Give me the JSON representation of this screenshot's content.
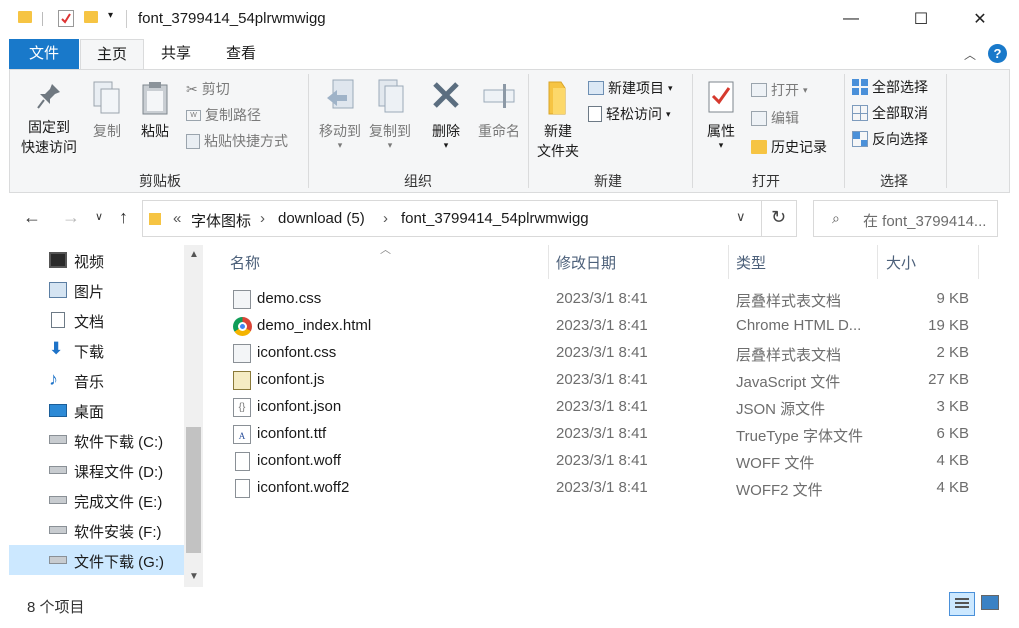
{
  "window": {
    "title": "font_3799414_54plrwmwigg",
    "controls": {
      "minimize": "—",
      "maximize": "☐",
      "close": "✕"
    }
  },
  "ribbon_tabs": [
    "文件",
    "主页",
    "共享",
    "查看"
  ],
  "ribbon": {
    "clipboard": {
      "group_label": "剪贴板",
      "pin_line1": "固定到",
      "pin_line2": "快速访问",
      "copy": "复制",
      "paste": "粘贴",
      "cut": "剪切",
      "copy_path": "复制路径",
      "paste_shortcut": "粘贴快捷方式"
    },
    "organize": {
      "group_label": "组织",
      "move_to": "移动到",
      "copy_to": "复制到",
      "delete": "删除",
      "rename": "重命名"
    },
    "new": {
      "group_label": "新建",
      "new_folder_line1": "新建",
      "new_folder_line2": "文件夹",
      "new_item": "新建项目",
      "easy_access": "轻松访问"
    },
    "open": {
      "group_label": "打开",
      "properties": "属性",
      "open": "打开",
      "edit": "编辑",
      "history": "历史记录"
    },
    "select": {
      "group_label": "选择",
      "select_all": "全部选择",
      "select_none": "全部取消",
      "invert": "反向选择"
    }
  },
  "address": {
    "overflow": "«",
    "crumbs": [
      "字体图标",
      "download (5)",
      "font_3799414_54plrwmwigg"
    ],
    "search_placeholder": "在 font_3799414..."
  },
  "nav_items": [
    {
      "label": "视频",
      "icon": "video-folder-icon"
    },
    {
      "label": "图片",
      "icon": "pictures-folder-icon"
    },
    {
      "label": "文档",
      "icon": "documents-folder-icon"
    },
    {
      "label": "下载",
      "icon": "downloads-folder-icon"
    },
    {
      "label": "音乐",
      "icon": "music-folder-icon"
    },
    {
      "label": "桌面",
      "icon": "desktop-folder-icon"
    },
    {
      "label": "软件下载 (C:)",
      "icon": "windows-drive-icon"
    },
    {
      "label": "课程文件 (D:)",
      "icon": "drive-icon"
    },
    {
      "label": "完成文件 (E:)",
      "icon": "drive-icon"
    },
    {
      "label": "软件安装 (F:)",
      "icon": "drive-icon"
    },
    {
      "label": "文件下载 (G:)",
      "icon": "drive-icon"
    }
  ],
  "columns": {
    "name": "名称",
    "date": "修改日期",
    "type": "类型",
    "size": "大小"
  },
  "files": [
    {
      "name": "demo.css",
      "date": "2023/3/1 8:41",
      "type": "层叠样式表文档",
      "size": "9 KB",
      "icon": "css-file-icon"
    },
    {
      "name": "demo_index.html",
      "date": "2023/3/1 8:41",
      "type": "Chrome HTML D...",
      "size": "19 KB",
      "icon": "chrome-icon"
    },
    {
      "name": "iconfont.css",
      "date": "2023/3/1 8:41",
      "type": "层叠样式表文档",
      "size": "2 KB",
      "icon": "css-file-icon"
    },
    {
      "name": "iconfont.js",
      "date": "2023/3/1 8:41",
      "type": "JavaScript 文件",
      "size": "27 KB",
      "icon": "js-file-icon"
    },
    {
      "name": "iconfont.json",
      "date": "2023/3/1 8:41",
      "type": "JSON 源文件",
      "size": "3 KB",
      "icon": "json-file-icon"
    },
    {
      "name": "iconfont.ttf",
      "date": "2023/3/1 8:41",
      "type": "TrueType 字体文件",
      "size": "6 KB",
      "icon": "font-file-icon"
    },
    {
      "name": "iconfont.woff",
      "date": "2023/3/1 8:41",
      "type": "WOFF 文件",
      "size": "4 KB",
      "icon": "blank-file-icon"
    },
    {
      "name": "iconfont.woff2",
      "date": "2023/3/1 8:41",
      "type": "WOFF2 文件",
      "size": "4 KB",
      "icon": "blank-file-icon"
    }
  ],
  "status": {
    "count_text": "8 个项目"
  },
  "colors": {
    "accent": "#1979ca",
    "selection": "#cce8ff",
    "folder": "#f6c443"
  }
}
